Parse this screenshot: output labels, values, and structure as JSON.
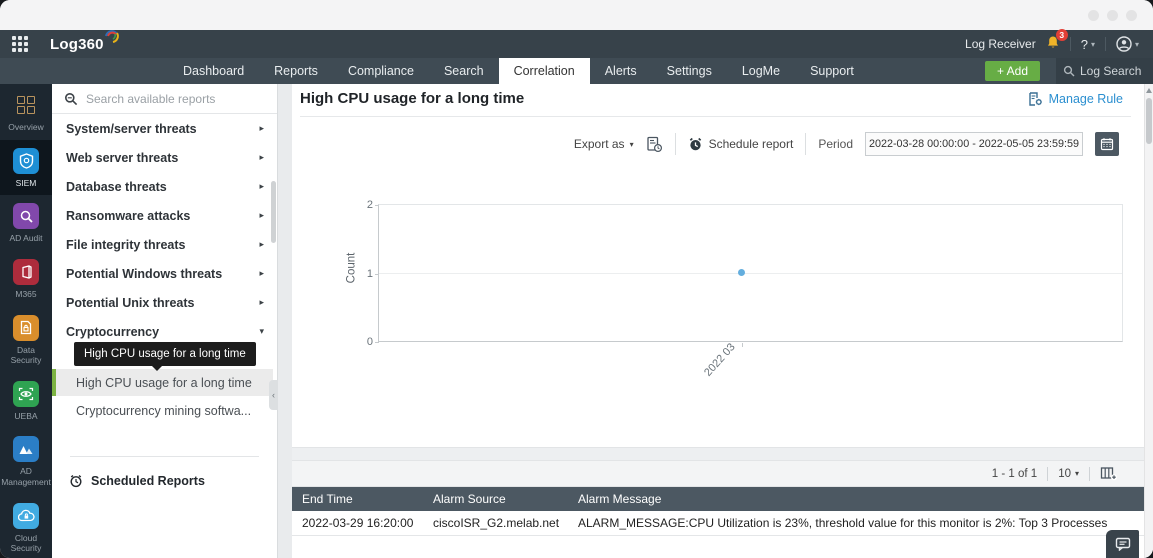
{
  "app": {
    "logo": "Log360",
    "nav": [
      "Dashboard",
      "Reports",
      "Compliance",
      "Search",
      "Correlation",
      "Alerts",
      "Settings",
      "LogMe",
      "Support"
    ],
    "active_nav": "Correlation",
    "top_right": {
      "log_receiver": "Log Receiver",
      "notification_count": "3",
      "help_label": "?",
      "add_label": "+ Add",
      "log_search_placeholder": "Log Search"
    }
  },
  "rail": {
    "items": [
      {
        "label": "Overview"
      },
      {
        "label": "SIEM",
        "active": true
      },
      {
        "label": "AD Audit"
      },
      {
        "label": "M365"
      },
      {
        "label": "Data Security"
      },
      {
        "label": "UEBA"
      },
      {
        "label": "AD Management"
      },
      {
        "label": "Cloud Security"
      }
    ]
  },
  "reports_panel": {
    "search_placeholder": "Search available reports",
    "categories": [
      {
        "label": "System/server threats",
        "state": "collapsed"
      },
      {
        "label": "Web server threats",
        "state": "collapsed"
      },
      {
        "label": "Database threats",
        "state": "collapsed"
      },
      {
        "label": "Ransomware attacks",
        "state": "collapsed"
      },
      {
        "label": "File integrity threats",
        "state": "collapsed"
      },
      {
        "label": "Potential Windows threats",
        "state": "collapsed"
      },
      {
        "label": "Potential Unix threats",
        "state": "collapsed"
      },
      {
        "label": "Cryptocurrency",
        "state": "expanded"
      }
    ],
    "tooltip_text": "High CPU usage for a long time",
    "items": [
      {
        "label": "High CPU usage for a long ti...",
        "selected": false
      },
      {
        "label": "High CPU usage for a long time",
        "selected": true
      },
      {
        "label": "Cryptocurrency mining softwa...",
        "selected": false
      }
    ],
    "scheduled_reports_label": "Scheduled Reports"
  },
  "main": {
    "title": "High CPU usage for a long time",
    "manage_rule_label": "Manage Rule",
    "toolbar": {
      "export_as_label": "Export as",
      "schedule_report_label": "Schedule report",
      "period_label": "Period",
      "period_value": "2022-03-28 00:00:00 - 2022-05-05 23:59:59"
    },
    "pagination": {
      "range": "1 - 1 of 1",
      "page_size": "10"
    },
    "table": {
      "columns": [
        "End Time",
        "Alarm Source",
        "Alarm Message"
      ],
      "rows": [
        [
          "2022-03-29 16:20:00",
          "ciscoISR_G2.melab.net",
          "ALARM_MESSAGE:CPU Utilization is 23%, threshold value for this monitor is 2%: Top 3 Processes"
        ]
      ]
    }
  },
  "chart_data": {
    "type": "scatter",
    "ylabel": "Count",
    "ylim": [
      0,
      2
    ],
    "yticks": [
      0,
      1,
      2
    ],
    "x_tick_labels": [
      "2022 03"
    ],
    "series": [
      {
        "name": "Count",
        "x": [
          "2022 03"
        ],
        "values": [
          1
        ]
      }
    ],
    "point_color": "#64aede",
    "grid": "horizontal-only",
    "legend": "none",
    "x_frac": [
      0.487
    ]
  },
  "icons": {
    "chevron_right": "▸",
    "chevron_down": "▾",
    "caret_down": "▾",
    "chevron_left": "‹"
  },
  "colors": {
    "accent_green": "#7cb342",
    "add_button_green": "#67ad45",
    "link_blue": "#2b8fd0",
    "badge_red": "#e23f36",
    "table_header": "#4c5862",
    "nav_dark": "#3f4b54",
    "rail_dark": "#1d2730",
    "point_blue": "#64aede"
  }
}
